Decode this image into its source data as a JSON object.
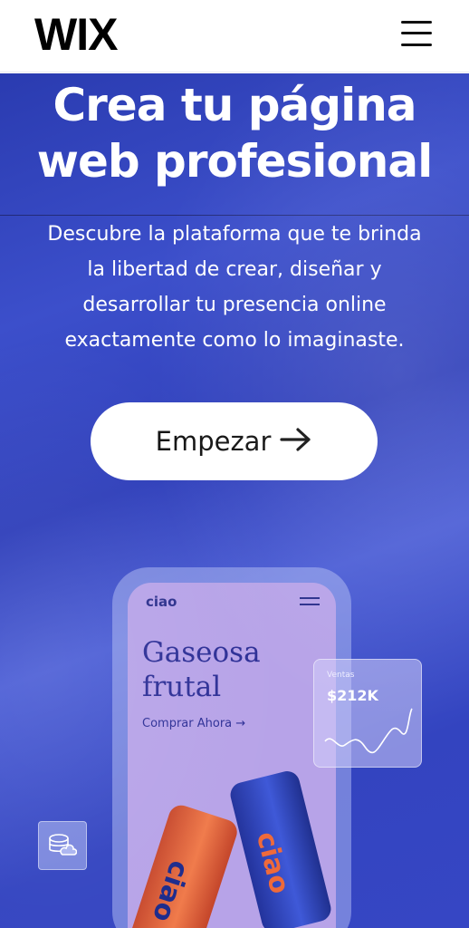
{
  "header": {
    "logo": "WIX",
    "menu_icon": "hamburger-menu-icon"
  },
  "hero": {
    "title_line1": "Crea tu página",
    "title_line2": "web profesional",
    "subtitle": "Descubre la plataforma que te brinda la libertad de crear, diseñar y desarrollar tu presencia online exactamente como lo imaginaste.",
    "cta_label": "Empezar",
    "cta_icon": "arrow-right-icon"
  },
  "phone_mockup": {
    "brand": "ciao",
    "headline_line1": "Gaseosa",
    "headline_line2": "frutal",
    "buy_label": "Comprar Ahora →",
    "can_label": "ciao"
  },
  "sales_card": {
    "label": "Ventas",
    "value": "$212K"
  },
  "colors": {
    "hero_blue": "#3646c4",
    "mockup_purple": "#b7a3e8",
    "brand_navy": "#2b2f8c"
  }
}
